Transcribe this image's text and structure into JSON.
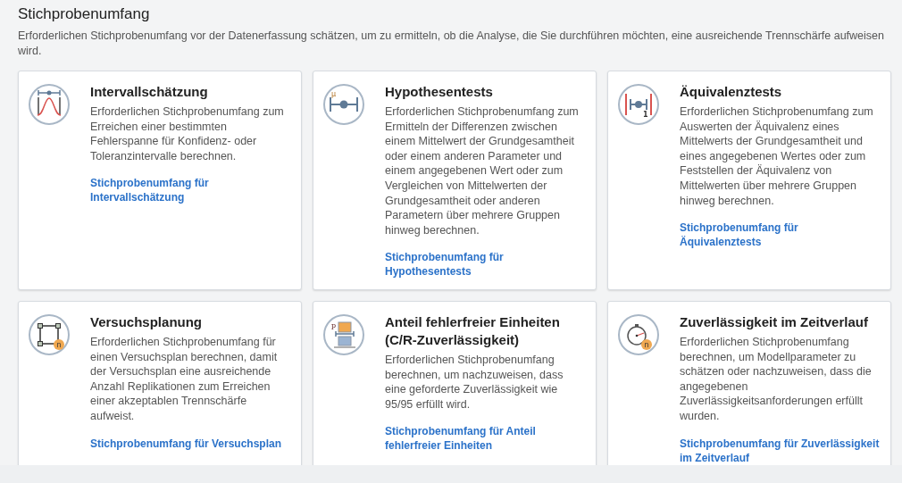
{
  "page": {
    "title": "Stichprobenumfang",
    "description": "Erforderlichen Stichprobenumfang vor der Datenerfassung schätzen, um zu ermitteln, ob die Analyse, die Sie durchführen möchten, eine ausreichende Trennschärfe aufweisen wird."
  },
  "cards": [
    {
      "kind": "interval",
      "title": "Intervallschätzung",
      "text": "Erforderlichen Stichprobenumfang zum Erreichen einer bestimmten Fehlerspanne für Konfidenz- oder Toleranzintervalle berechnen.",
      "link": "Stichprobenumfang für Intervallschätzung"
    },
    {
      "kind": "hypothesis",
      "icon_label": "μ",
      "title": "Hypothesentests",
      "text": "Erforderlichen Stichprobenumfang zum Ermitteln der Differenzen zwischen einem Mittelwert der Grundgesamtheit oder einem anderen Parameter und einem angegebenen Wert oder zum Vergleichen von Mittelwerten der Grundgesamtheit oder anderen Parametern über mehrere Gruppen hinweg berechnen.",
      "link": "Stichprobenumfang für Hypothesentests"
    },
    {
      "kind": "equivalence",
      "icon_label": "1",
      "title": "Äquivalenztests",
      "text": "Erforderlichen Stichprobenumfang zum Auswerten der Äquivalenz eines Mittelwerts der Grundgesamtheit und eines angegebenen Wertes oder zum Feststellen der Äquivalenz von Mittelwerten über mehrere Gruppen hinweg berechnen.",
      "link": "Stichprobenumfang für Äquivalenztests"
    },
    {
      "kind": "doe",
      "icon_label": "n",
      "title": "Versuchsplanung",
      "text": "Erforderlichen Stichprobenumfang für einen Versuchsplan berechnen, damit der Versuchsplan eine ausreichende Anzahl Replikationen zum Erreichen einer akzeptablen Trennschärfe aufweist.",
      "link": "Stichprobenumfang für Versuchsplan"
    },
    {
      "kind": "proportion",
      "icon_label": "p",
      "title": "Anteil fehlerfreier Einheiten (C/R-Zuverlässigkeit)",
      "text": "Erforderlichen Stichprobenumfang berechnen, um nachzuweisen, dass eine geforderte Zuverlässigkeit wie 95/95 erfüllt wird.",
      "link": "Stichprobenumfang für Anteil fehlerfreier Einheiten"
    },
    {
      "kind": "reliability",
      "icon_label": "n",
      "title": "Zuverlässigkeit im Zeitverlauf",
      "text": "Erforderlichen Stichprobenumfang berechnen, um Modellparameter zu schätzen oder nachzuweisen, dass die angegebenen Zuverlässigkeitsanforderungen erfüllt wurden.",
      "link": "Stichprobenumfang für Zuverlässigkeit im Zeitverlauf"
    }
  ]
}
